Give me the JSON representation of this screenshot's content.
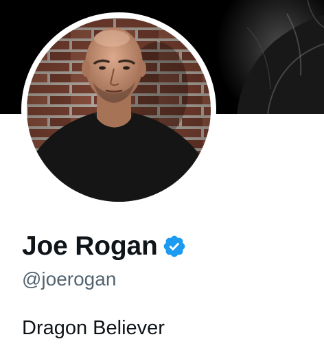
{
  "profile": {
    "display_name": "Joe Rogan",
    "handle": "@joerogan",
    "bio": "Dragon Believer",
    "verified": true
  },
  "icons": {
    "verified": "verified-badge-icon"
  },
  "colors": {
    "name_text": "#0f1419",
    "handle_text": "#536471",
    "verified_blue": "#1d9bf0",
    "banner_bg": "#000000",
    "page_bg": "#ffffff"
  }
}
